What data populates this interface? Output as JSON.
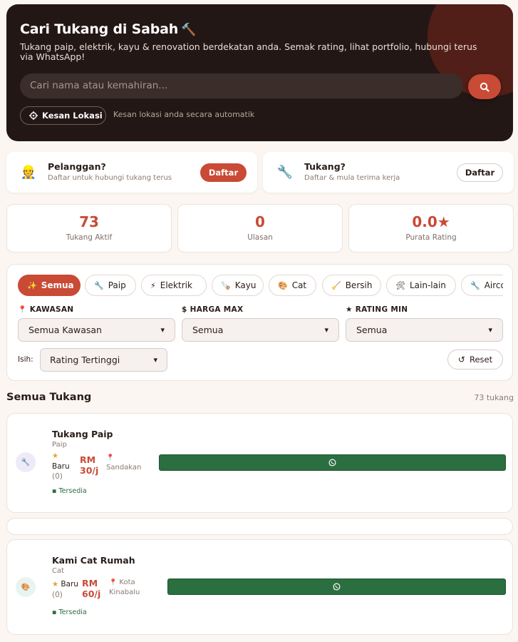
{
  "hero": {
    "title": "Cari Tukang di Sabah",
    "title_icon": "🔨",
    "subtitle": "Tukang paip, elektrik, kayu & renovation berdekatan anda. Semak rating, lihat portfolio, hubungi terus via WhatsApp!",
    "search_placeholder": "Cari nama atau kemahiran...",
    "detect_location_label": "Kesan Lokasi",
    "detect_location_hint": "Kesan lokasi anda secara automatik"
  },
  "roles": [
    {
      "icon": "👷",
      "title": "Pelanggan?",
      "desc": "Daftar untuk hubungi tukang terus",
      "button": "Daftar"
    },
    {
      "icon": "🔧",
      "title": "Tukang?",
      "desc": "Daftar & mula terima kerja",
      "button": "Daftar"
    }
  ],
  "stats": [
    {
      "value": "73",
      "label": "Tukang Aktif"
    },
    {
      "value": "0",
      "label": "Ulasan"
    },
    {
      "value": "0.0★",
      "label": "Purata Rating"
    }
  ],
  "filters": {
    "chips": [
      {
        "icon": "✨",
        "label": "Semua"
      },
      {
        "icon": "🔧",
        "label": "Paip"
      },
      {
        "icon": "⚡",
        "label": "Elektrik"
      },
      {
        "icon": "🪚",
        "label": "Kayu"
      },
      {
        "icon": "🎨",
        "label": "Cat"
      },
      {
        "icon": "🧹",
        "label": "Bersih"
      },
      {
        "icon": "🛠",
        "label": "Lain-lain"
      },
      {
        "icon": "🔧",
        "label": "Aircon"
      }
    ],
    "kawasan_label": "KAWASAN",
    "kawasan_value": "Semua Kawasan",
    "harga_label": "HARGA MAX",
    "harga_value": "Semua",
    "rating_label": "RATING MIN",
    "rating_value": "Semua",
    "sort_label": "Isih:",
    "sort_value": "Rating Tertinggi",
    "reset_label": "Reset"
  },
  "list": {
    "title": "Semua Tukang",
    "count": "73 tukang"
  },
  "tradespeople": [
    {
      "name": "Tukang Paip",
      "category": "Paip",
      "rating_label": "Baru",
      "reviews": "(0)",
      "price_line1": "RM",
      "price_line2": "30/j",
      "location_line1": "",
      "location_line2": "Sandakan",
      "status": "Tersedia"
    },
    {
      "name": "Kami Cat Rumah",
      "category": "Cat",
      "rating_label": "Baru",
      "reviews": "(0)",
      "price_line1": "RM",
      "price_line2": "60/j",
      "location_line1": "Kota",
      "location_line2": "Kinabalu",
      "status": "Tersedia"
    }
  ],
  "colors": {
    "accent": "#c94a35",
    "hero_bg": "#231715",
    "whatsapp": "#2b6e3f",
    "page_bg": "#fbf6f2"
  }
}
